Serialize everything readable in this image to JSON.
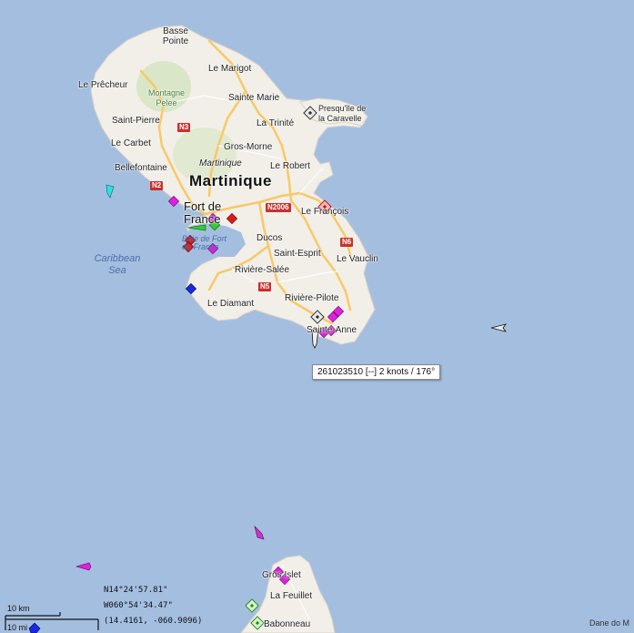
{
  "map": {
    "water_color": "#a4bee0",
    "land_color": "#f2efe9",
    "road_color": "#f7c966",
    "island_label": "Martinique",
    "sea_label": "Caribbean Sea",
    "places": {
      "basse_pointe": "Basse Pointe",
      "le_marigot": "Le Marigot",
      "le_precheur": "Le Prêcheur",
      "montagne_pelee": "Montagne Pelee",
      "sainte_marie": "Sainte Marie",
      "presquile": "Presqu'île de la Caravelle",
      "saint_pierre": "Saint-Pierre",
      "la_trinite": "La Trinité",
      "le_carbet": "Le Carbet",
      "gros_morne": "Gros-Morne",
      "martinique_small": "Martinique",
      "bellefontaine": "Bellefontaine",
      "le_robert": "Le Robert",
      "fort_de_france": "Fort de France",
      "baie_fort_de_france": "Baie de Fort de France",
      "le_francois": "Le François",
      "ducos": "Ducos",
      "saint_esprit": "Saint-Esprit",
      "le_vauclin": "Le Vauclin",
      "riviere_salee": "Rivière-Salée",
      "le_diamant": "Le Diamant",
      "riviere_pilote": "Rivière-Pilote",
      "sainte_anne": "Sainte-Anne",
      "gros_islet": "Gros Islet",
      "la_feuillet": "La Feuillet",
      "babonneau": "Babonneau"
    },
    "roads": [
      "N3",
      "N2",
      "N2006",
      "N6",
      "N5"
    ]
  },
  "tooltip": "261023510 [--] 2 knots / 176°",
  "cursor_position": {
    "lat_dms": "N14°24'57.81\"",
    "lon_dms": "W060°54'34.47\"",
    "decimal": "(14.4161, -060.9096)"
  },
  "scale": {
    "km": "10 km",
    "mi": "10 mi"
  },
  "attribution": "Dane do M",
  "vessel_colors": {
    "passenger": "#e020e0",
    "tanker": "#dd1a1a",
    "cargo": "#33cc33",
    "tug": "#1a2bdd",
    "pleasure": "#cc33cc",
    "fishing": "#33e0e0",
    "unknown": "#cfcfcf",
    "nav_aid": "#e8e8e8"
  }
}
